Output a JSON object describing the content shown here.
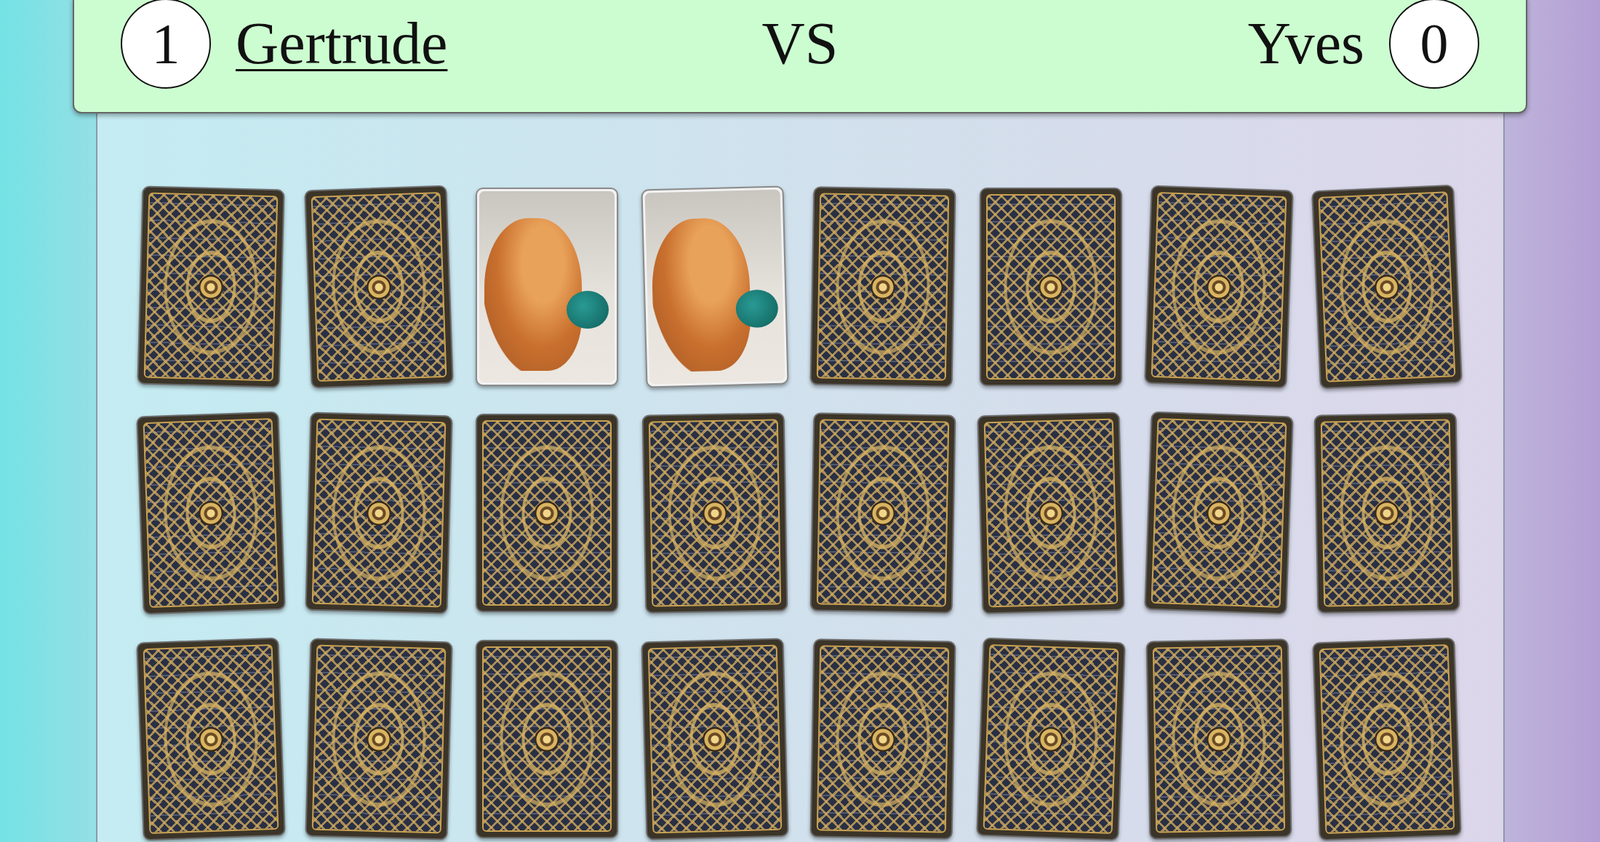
{
  "players": [
    {
      "name": "Gertrude",
      "score": "1",
      "selected": true
    },
    {
      "name": "Yves",
      "score": "0",
      "selected": false
    }
  ],
  "versus": "VS",
  "cards": [
    {
      "faceUp": false
    },
    {
      "faceUp": false
    },
    {
      "faceUp": true
    },
    {
      "faceUp": true
    },
    {
      "faceUp": false
    },
    {
      "faceUp": false
    },
    {
      "faceUp": false
    },
    {
      "faceUp": false
    },
    {
      "faceUp": false
    },
    {
      "faceUp": false
    },
    {
      "faceUp": false
    },
    {
      "faceUp": false
    },
    {
      "faceUp": false
    },
    {
      "faceUp": false
    },
    {
      "faceUp": false
    },
    {
      "faceUp": false
    },
    {
      "faceUp": false
    },
    {
      "faceUp": false
    },
    {
      "faceUp": false
    },
    {
      "faceUp": false
    },
    {
      "faceUp": false
    },
    {
      "faceUp": false
    },
    {
      "faceUp": false
    },
    {
      "faceUp": false
    }
  ]
}
